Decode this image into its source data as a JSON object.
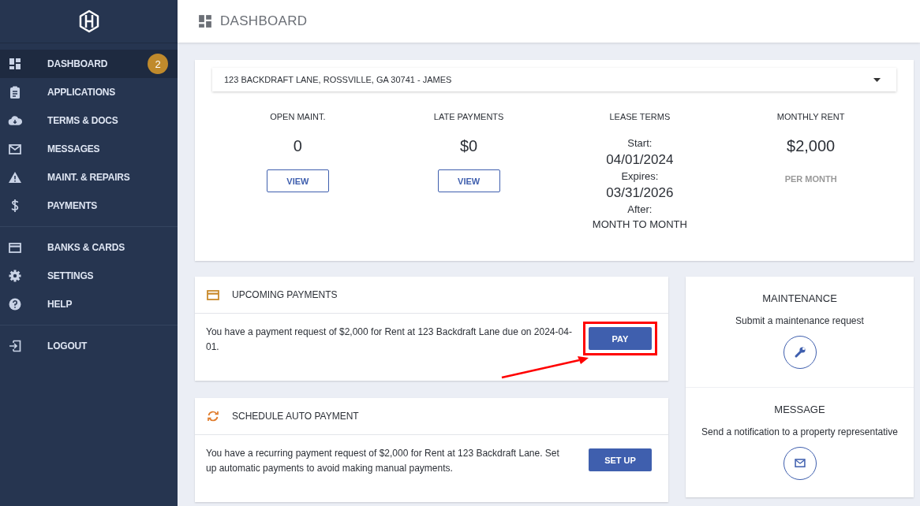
{
  "header": {
    "title": "DASHBOARD"
  },
  "sidebar": {
    "groups": [
      [
        {
          "label": "DASHBOARD",
          "kind": "dashboard",
          "selected": true,
          "badge": "2"
        },
        {
          "label": "APPLICATIONS",
          "kind": "clipboard",
          "selected": false
        },
        {
          "label": "TERMS & DOCS",
          "kind": "cloud",
          "selected": false
        },
        {
          "label": "MESSAGES",
          "kind": "mail",
          "selected": false
        },
        {
          "label": "MAINT. & REPAIRS",
          "kind": "warning",
          "selected": false
        },
        {
          "label": "PAYMENTS",
          "kind": "dollar",
          "selected": false
        }
      ],
      [
        {
          "label": "BANKS & CARDS",
          "kind": "card",
          "selected": false
        },
        {
          "label": "SETTINGS",
          "kind": "gear",
          "selected": false
        },
        {
          "label": "HELP",
          "kind": "help",
          "selected": false
        }
      ],
      [
        {
          "label": "LOGOUT",
          "kind": "logout",
          "selected": false
        }
      ]
    ]
  },
  "property_select": {
    "value": "123 BACKDRAFT LANE, ROSSVILLE, GA 30741 - JAMES"
  },
  "stats": [
    {
      "kind": "button",
      "label": "OPEN MAINT.",
      "value": "0",
      "button": "VIEW"
    },
    {
      "kind": "button",
      "label": "LATE PAYMENTS",
      "value": "$0",
      "button": "VIEW"
    },
    {
      "kind": "lease",
      "label": "LEASE TERMS",
      "start_label": "Start:",
      "start": "04/01/2024",
      "expires_label": "Expires:",
      "expires": "03/31/2026",
      "after_label": "After:",
      "after": "MONTH TO MONTH"
    },
    {
      "kind": "note",
      "label": "MONTHLY RENT",
      "value": "$2,000",
      "note": "PER MONTH"
    }
  ],
  "cards": [
    {
      "kind": "card",
      "title": "UPCOMING PAYMENTS",
      "text": "You have a payment request of $2,000 for Rent at 123 Backdraft Lane due on 2024-04-01.",
      "button": "PAY",
      "highlighted": true
    },
    {
      "kind": "sync",
      "title": "SCHEDULE AUTO PAYMENT",
      "text": "You have a recurring payment request of $2,000 for Rent at 123 Backdraft Lane. Set up automatic payments to avoid making manual payments.",
      "button": "SET UP",
      "highlighted": false
    }
  ],
  "actions": [
    {
      "kind": "wrench",
      "title": "MAINTENANCE",
      "text": "Submit a maintenance request"
    },
    {
      "kind": "mail",
      "title": "MESSAGE",
      "text": "Send a notification to a property representative"
    }
  ]
}
